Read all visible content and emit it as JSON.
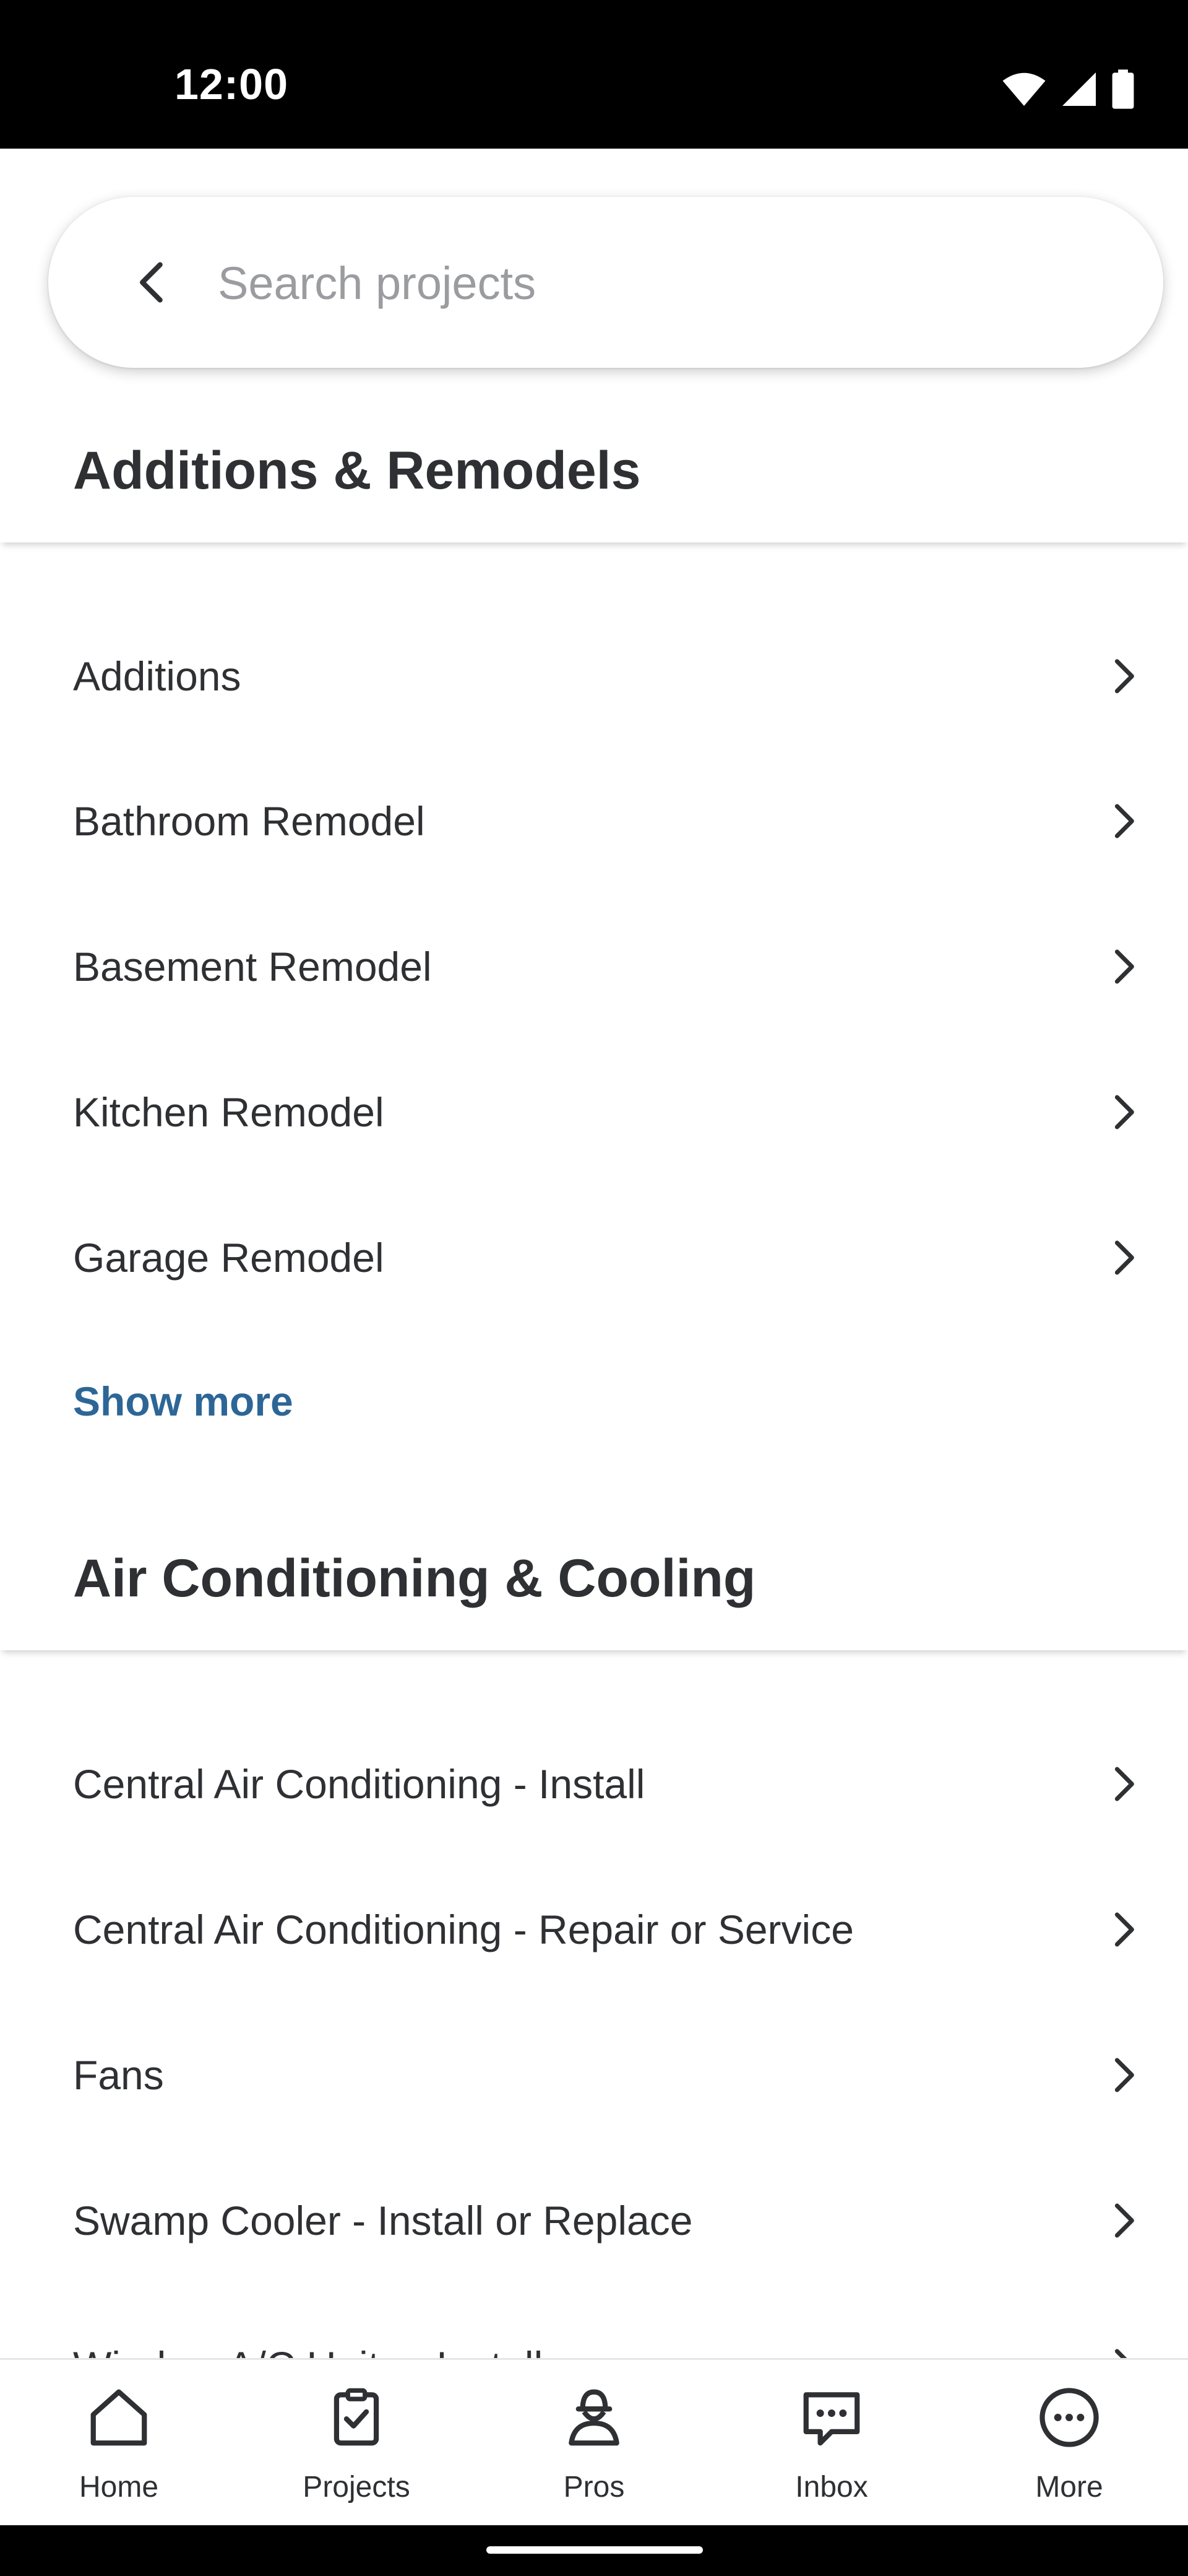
{
  "status_bar": {
    "time": "12:00",
    "icons": [
      "wifi-icon",
      "signal-icon",
      "battery-icon"
    ]
  },
  "search": {
    "placeholder": "Search projects",
    "value": ""
  },
  "sections": [
    {
      "title": "Additions & Remodels",
      "items": [
        "Additions",
        "Bathroom Remodel",
        "Basement Remodel",
        "Kitchen Remodel",
        "Garage Remodel"
      ],
      "show_more": "Show more"
    },
    {
      "title": "Air Conditioning & Cooling",
      "items": [
        "Central Air Conditioning - Install",
        "Central Air Conditioning - Repair or Service",
        "Fans",
        "Swamp Cooler - Install or Replace",
        "Window A/C Units - Install"
      ]
    }
  ],
  "bottom_nav": [
    {
      "label": "Home",
      "icon": "home-icon"
    },
    {
      "label": "Projects",
      "icon": "clipboard-check-icon"
    },
    {
      "label": "Pros",
      "icon": "pro-person-icon"
    },
    {
      "label": "Inbox",
      "icon": "chat-bubble-icon"
    },
    {
      "label": "More",
      "icon": "more-dots-icon"
    }
  ],
  "colors": {
    "link": "#2d6696",
    "text": "#2f3033",
    "placeholder": "#9b9ca0"
  }
}
